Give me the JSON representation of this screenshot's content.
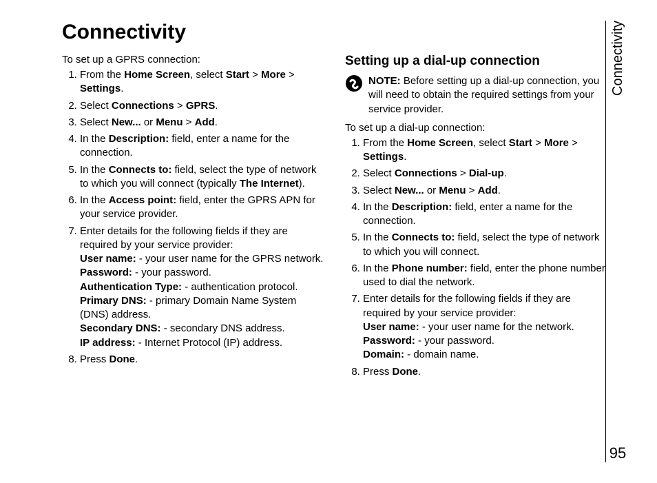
{
  "page": {
    "title": "Connectivity",
    "side_label": "Connectivity",
    "page_number": "95"
  },
  "left": {
    "intro": "To set up a GPRS connection:",
    "steps": {
      "s1": {
        "pre": "From the ",
        "b1": "Home Screen",
        "mid1": ", select ",
        "b2": "Start",
        "gt1": " > ",
        "b3": "More",
        "gt2": " > ",
        "b4": "Settings",
        "post": "."
      },
      "s2": {
        "pre": "Select ",
        "b1": "Connections",
        "gt": " > ",
        "b2": "GPRS",
        "post": "."
      },
      "s3": {
        "pre": "Select ",
        "b1": "New...",
        "or": " or ",
        "b2": "Menu",
        "gt": " > ",
        "b3": "Add",
        "post": "."
      },
      "s4": {
        "pre": "In the ",
        "b1": "Description:",
        "post": " field, enter a name for the connection."
      },
      "s5": {
        "pre": "In the ",
        "b1": "Connects to:",
        "mid": " field, select the type of network to which you will connect (typically ",
        "b2": "The Internet",
        "post": ")."
      },
      "s6": {
        "pre": "In the ",
        "b1": "Access point:",
        "post": " field, enter the GPRS APN for your service provider."
      },
      "s7": {
        "lead": "Enter details for the following fields if they are required by your service provider:",
        "f1b": "User name:",
        "f1t": " - your user name for the GPRS network.",
        "f2b": "Password:",
        "f2t": " - your password.",
        "f3b": "Authentication Type:",
        "f3t": " - authentication protocol.",
        "f4b": "Primary DNS:",
        "f4t": " - primary Domain Name System (DNS) address.",
        "f5b": "Secondary DNS:",
        "f5t": " - secondary DNS address.",
        "f6b": "IP address:",
        "f6t": " - Internet Protocol (IP) address."
      },
      "s8": {
        "pre": "Press ",
        "b1": "Done",
        "post": "."
      }
    }
  },
  "right": {
    "heading": "Setting up a dial-up connection",
    "note": {
      "label": "NOTE:",
      "text": " Before setting up a dial-up connection, you will need to obtain the required settings from your service provider."
    },
    "intro": "To set up a dial-up connection:",
    "steps": {
      "s1": {
        "pre": "From the ",
        "b1": "Home Screen",
        "mid1": ", select ",
        "b2": "Start",
        "gt1": " > ",
        "b3": "More",
        "gt2": " > ",
        "b4": "Settings",
        "post": "."
      },
      "s2": {
        "pre": "Select ",
        "b1": "Connections",
        "gt": " > ",
        "b2": "Dial-up",
        "post": "."
      },
      "s3": {
        "pre": "Select ",
        "b1": "New...",
        "or": " or ",
        "b2": "Menu",
        "gt": " > ",
        "b3": "Add",
        "post": "."
      },
      "s4": {
        "pre": "In the ",
        "b1": "Description:",
        "post": " field, enter a name for the connection."
      },
      "s5": {
        "pre": "In the ",
        "b1": "Connects to:",
        "post": " field, select the type of network to which you will connect."
      },
      "s6": {
        "pre": "In the ",
        "b1": "Phone number:",
        "post": " field, enter the phone number used to dial the network."
      },
      "s7": {
        "lead": "Enter details for the following fields if they are required by your service provider:",
        "f1b": "User name:",
        "f1t": " - your user name for the network.",
        "f2b": "Password:",
        "f2t": " - your password.",
        "f3b": "Domain:",
        "f3t": " - domain name."
      },
      "s8": {
        "pre": "Press ",
        "b1": "Done",
        "post": "."
      }
    }
  }
}
